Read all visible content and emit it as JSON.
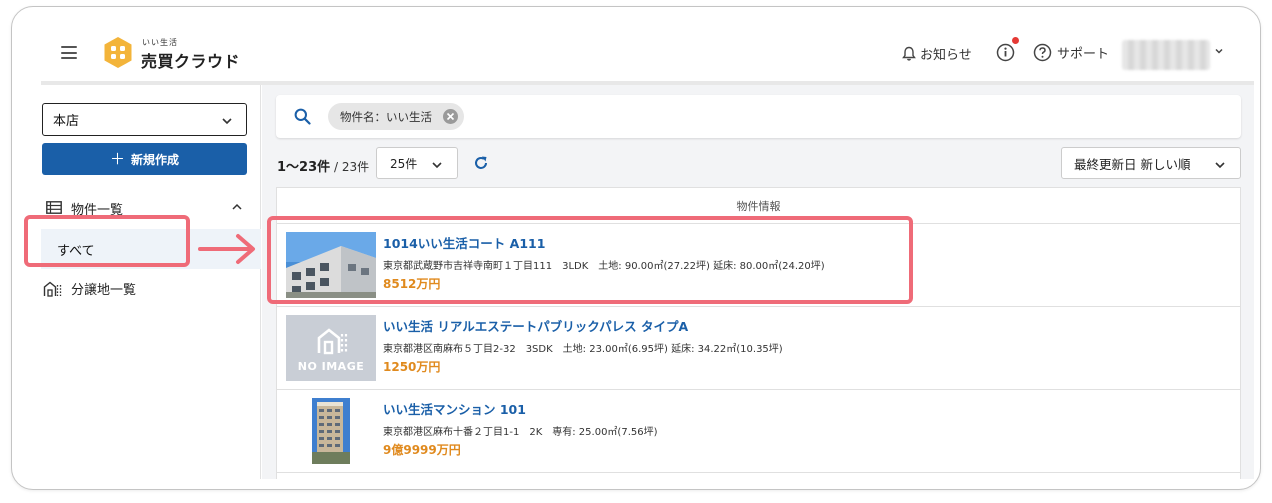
{
  "header": {
    "logo_sub": "いい生活",
    "logo_main": "売買クラウド",
    "notify_label": "お知らせ",
    "support_label": "サポート"
  },
  "sidebar": {
    "store_select": "本店",
    "new_button": "新規作成",
    "nav_group": "物件一覧",
    "nav_all": "すべて",
    "nav_lots": "分譲地一覧"
  },
  "search": {
    "chip": "物件名：いい生活"
  },
  "list": {
    "count_range": "1〜23件",
    "count_total": " / 23件",
    "per_page": "25件",
    "sort": "最終更新日 新しい順",
    "column_header": "物件情報",
    "no_image_label": "NO IMAGE"
  },
  "properties": [
    {
      "title": "1014いい生活コート A111",
      "address": "東京都武蔵野市吉祥寺南町１丁目111　3LDK　土地: 90.00㎡(27.22坪) 延床: 80.00㎡(24.20坪)",
      "price": "8512万円"
    },
    {
      "title": "いい生活 リアルエステートパブリックパレス タイプA",
      "address": "東京都港区南麻布５丁目2-32　3SDK　土地: 23.00㎡(6.95坪) 延床: 34.22㎡(10.35坪)",
      "price": "1250万円"
    },
    {
      "title": "いい生活マンション 101",
      "address": "東京都港区麻布十番２丁目1-1　2K　専有: 25.00㎡(7.56坪)",
      "price": "9億9999万円"
    }
  ],
  "colors": {
    "brand_blue": "#1a5fa8",
    "price_orange": "#e08a1e",
    "logo_yellow": "#f3b43a",
    "annotation_pink": "#ef6b78"
  }
}
